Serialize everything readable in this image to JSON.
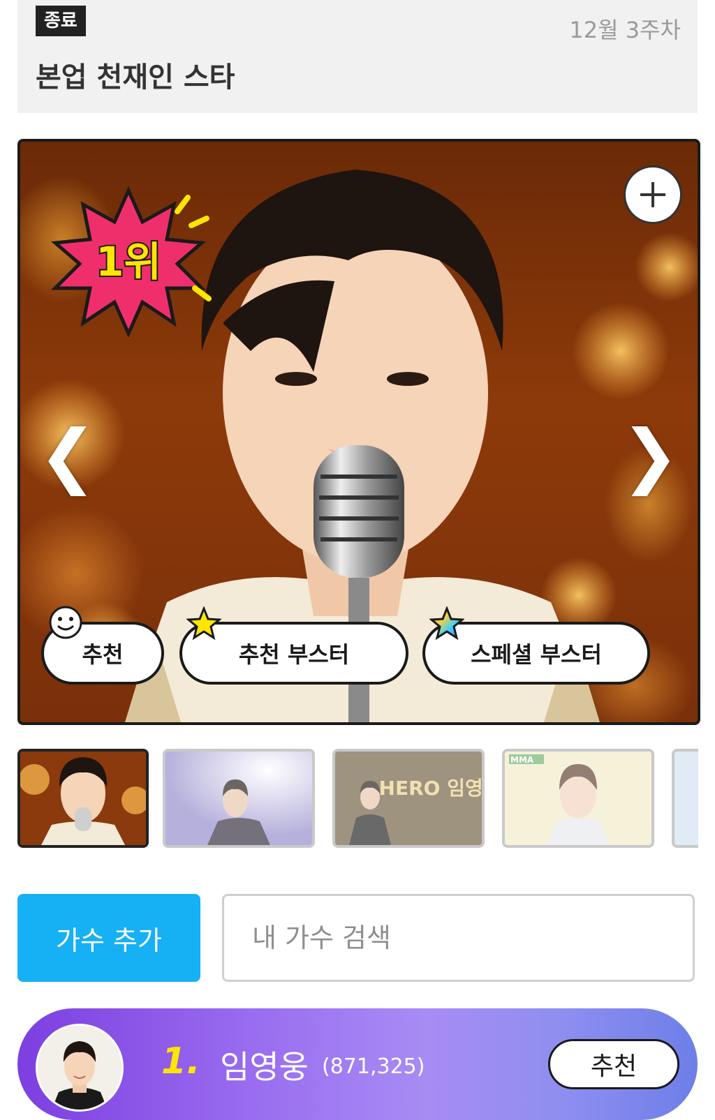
{
  "header": {
    "status_badge": "종료",
    "week_label": "12월 3주차",
    "title": "본업 천재인 스타"
  },
  "hero": {
    "rank_badge": "1위",
    "add_icon": "plus-icon",
    "prev_arrow": "❮",
    "next_arrow": "❯",
    "buttons": {
      "recommend": "추천",
      "recommend_booster": "추천 부스터",
      "special_booster": "스페셜 부스터"
    }
  },
  "thumbnails": {
    "count": 5,
    "selected_index": 0,
    "items": [
      {
        "label": ""
      },
      {
        "label": ""
      },
      {
        "label": "HERO 임영웅"
      },
      {
        "label": "MMA"
      }
    ]
  },
  "search": {
    "add_singer_label": "가수 추가",
    "placeholder": "내 가수 검색"
  },
  "ranking": {
    "rank": "1.",
    "name": "임영웅",
    "votes": "(871,325)",
    "recommend_label": "추천"
  },
  "colors": {
    "accent_blue": "#16b0f5",
    "rank_gradient_start": "#7d3fe0",
    "rank_gradient_end": "#6d7fe8",
    "rank_number": "#ffe600",
    "badge_pink": "#ef2f6b"
  }
}
